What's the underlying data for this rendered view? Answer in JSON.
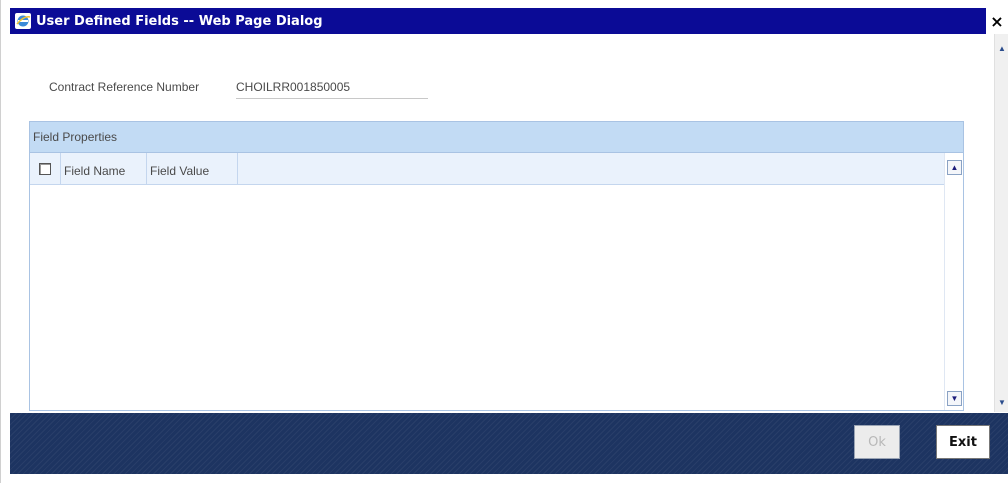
{
  "window": {
    "title": "User Defined Fields -- Web Page Dialog",
    "close_glyph": "×"
  },
  "form": {
    "contract_reference_label": "Contract Reference Number",
    "contract_reference_value": "CHOILRR001850005"
  },
  "field_properties": {
    "section_title": "Field Properties",
    "columns": [
      "Field Name",
      "Field Value"
    ],
    "rows": []
  },
  "footer": {
    "ok_label": "Ok",
    "exit_label": "Exit"
  },
  "icons": {
    "title_icon": "ie-page-icon",
    "up_arrow": "▲",
    "down_arrow": "▼"
  },
  "colors": {
    "titlebar": "#0b0b96",
    "section_header": "#c2dbf4",
    "footer": "#1d3461"
  }
}
